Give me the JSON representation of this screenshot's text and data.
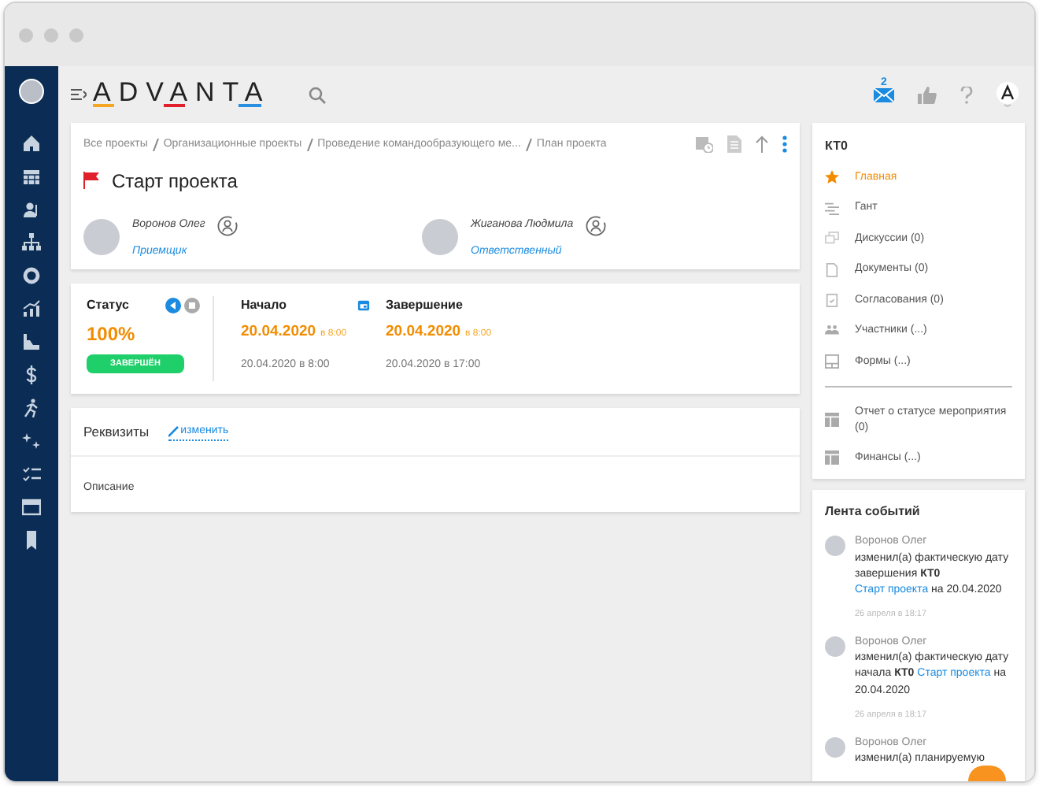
{
  "header": {
    "logo": "ADVANTA",
    "mail_count": "2"
  },
  "breadcrumbs": [
    "Все проекты",
    "Организационные проекты",
    "Проведение командообразующего ме...",
    "План проекта"
  ],
  "title": "Старт проекта",
  "people": [
    {
      "name": "Воронов Олег",
      "role": "Приемщик"
    },
    {
      "name": "Жиганова Людмила",
      "role": "Ответственный"
    }
  ],
  "status": {
    "label": "Статус",
    "percent": "100%",
    "badge": "ЗАВЕРШЁН"
  },
  "dates": [
    {
      "label": "Начало",
      "planned_date": "20.04.2020",
      "planned_time": "в 8:00",
      "actual": "20.04.2020 в 8:00"
    },
    {
      "label": "Завершение",
      "planned_date": "20.04.2020",
      "planned_time": "в 8:00",
      "actual": "20.04.2020 в 17:00"
    }
  ],
  "details": {
    "title": "Реквизиты",
    "edit_link": "изменить",
    "description_label": "Описание"
  },
  "nav": {
    "title": "КТ0",
    "groups": [
      {
        "items": [
          {
            "label": "Главная",
            "selected": true
          },
          {
            "label": "Гант",
            "selected": false
          },
          {
            "label": "Дискуссии (0)",
            "selected": false
          },
          {
            "label": "Документы (0)",
            "selected": false
          },
          {
            "label": "Согласования (0)",
            "selected": false
          },
          {
            "label": "Участники (...)",
            "selected": false
          },
          {
            "label": "Формы (...)",
            "selected": false
          }
        ]
      },
      {
        "items": [
          {
            "label": "Отчет о статусе мероприятия (0)",
            "selected": false
          },
          {
            "label": "Финансы (...)",
            "selected": false
          }
        ]
      }
    ]
  },
  "feed": {
    "title": "Лента событий",
    "events": [
      {
        "author": "Воронов Олег",
        "action": "изменил(а) фактическую дату завершения **КТ0**",
        "link": "Старт проекта",
        "after": "на 20.04.2020",
        "time": "26 апреля в 18:17"
      },
      {
        "author": "Воронов Олег",
        "action": "изменил(а) фактическую дату начала **КТ0**",
        "link": "Старт проекта",
        "after": "на 20.04.2020",
        "time": "26 апреля в 18:17"
      },
      {
        "author": "Воронов Олег",
        "action": "изменил(а) планируемую"
      }
    ]
  }
}
